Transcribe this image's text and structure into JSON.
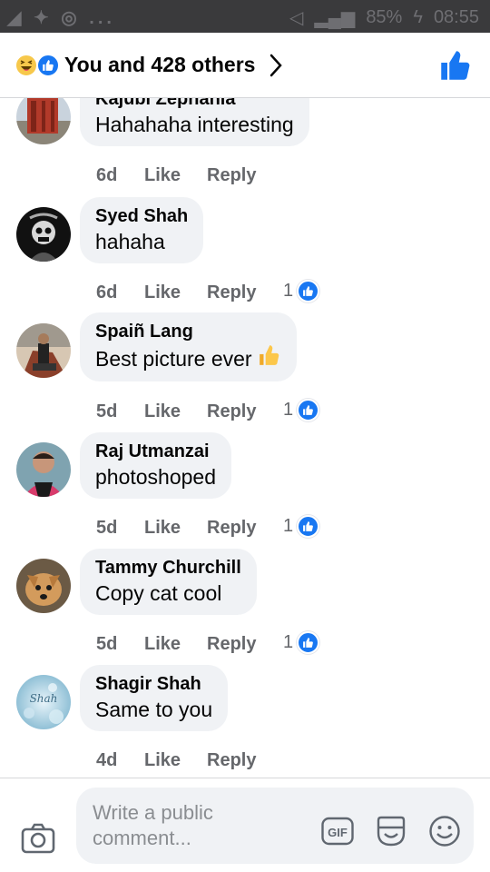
{
  "status_bar": {
    "battery": "85%",
    "time": "08:55"
  },
  "header": {
    "title": "You and 428 others",
    "reaction_icons": [
      "haha-icon",
      "like-icon"
    ],
    "colors": {
      "accent": "#1877f2"
    }
  },
  "comments": [
    {
      "name": "Kajubi Zephania",
      "text": "Hahahaha interesting",
      "age": "6d",
      "like": "Like",
      "reply": "Reply",
      "likes": ""
    },
    {
      "name": "Syed Shah",
      "text": "hahaha",
      "age": "6d",
      "like": "Like",
      "reply": "Reply",
      "likes": "1"
    },
    {
      "name": "Spaiñ Lang",
      "text": "Best picture ever",
      "age": "5d",
      "like": "Like",
      "reply": "Reply",
      "likes": "1"
    },
    {
      "name": "Raj Utmanzai",
      "text": "photoshoped",
      "age": "5d",
      "like": "Like",
      "reply": "Reply",
      "likes": "1"
    },
    {
      "name": "Tammy Churchill",
      "text": "Copy cat cool",
      "age": "5d",
      "like": "Like",
      "reply": "Reply",
      "likes": "1"
    },
    {
      "name": "Shagir Shah",
      "text": "Same to you",
      "age": "4d",
      "like": "Like",
      "reply": "Reply",
      "likes": "",
      "avatar_text": "Shah"
    }
  ],
  "composer": {
    "placeholder": "Write a public comment...",
    "gif_label": "GIF"
  }
}
